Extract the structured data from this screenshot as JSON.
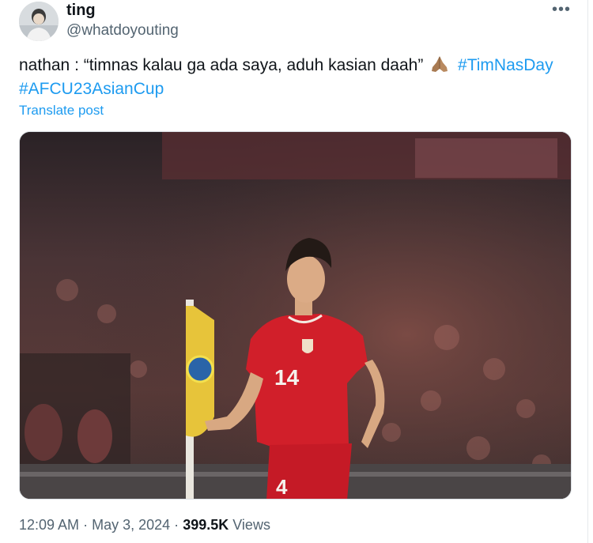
{
  "tweet": {
    "author": {
      "display_name": "ting",
      "handle": "@whatdoyouting"
    },
    "more_icon": "more-horizontal-icon",
    "text": {
      "body": "nathan : “timnas kalau ga ada saya, aduh kasian daah”",
      "emoji": "folded-hands-emoji",
      "hashtags": [
        "#TimNasDay",
        "#AFCU23AsianCup"
      ]
    },
    "translate_label": "Translate post",
    "media": {
      "jersey_number": "14",
      "shorts_number": "4"
    },
    "meta": {
      "time": "12:09 AM",
      "separator": "·",
      "date": "May 3, 2024",
      "views_count": "399.5K",
      "views_label": "Views"
    },
    "colors": {
      "link": "#1d9bf0",
      "text": "#0f1419",
      "secondary": "#536471"
    }
  }
}
